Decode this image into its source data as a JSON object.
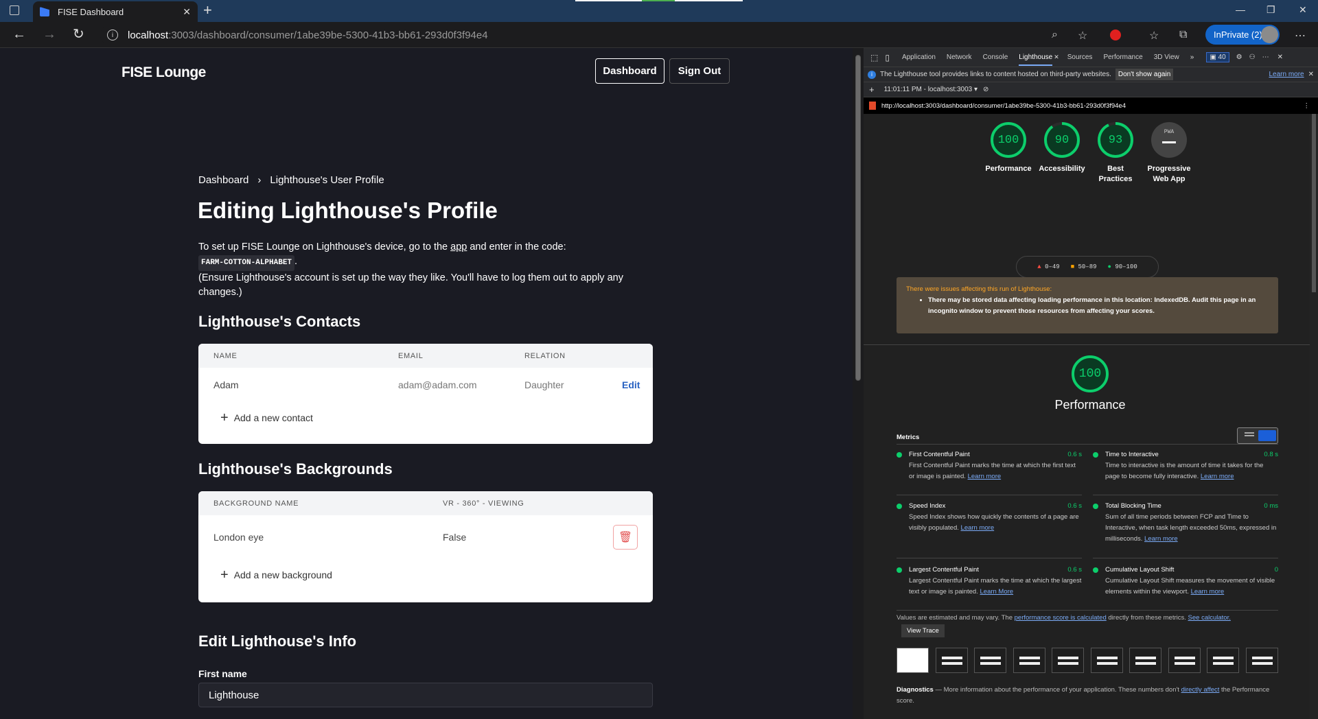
{
  "browser": {
    "tab_title": "FISE Dashboard",
    "url_host": "localhost",
    "url_path": ":3003/dashboard/consumer/1abe39be-5300-41b3-bb61-293d0f3f94e4",
    "inprivate_label": "InPrivate (2)"
  },
  "header": {
    "brand": "FISE Lounge",
    "dashboard_button": "Dashboard",
    "signout_button": "Sign Out"
  },
  "breadcrumb": {
    "root": "Dashboard",
    "separator": "›",
    "current": "Lighthouse's User Profile"
  },
  "page_title": "Editing Lighthouse's Profile",
  "intro": {
    "line1_prefix": "To set up FISE Lounge on Lighthouse's device, go to the ",
    "line1_link": "app",
    "line1_suffix": " and enter in the code:",
    "code": "FARM-COTTON-ALPHABET",
    "code_suffix": ".",
    "line2": "(Ensure Lighthouse's account is set up the way they like. You'll have to log them out to apply any changes.)"
  },
  "contacts": {
    "heading": "Lighthouse's Contacts",
    "columns": [
      "NAME",
      "EMAIL",
      "RELATION"
    ],
    "rows": [
      {
        "name": "Adam",
        "email": "adam@adam.com",
        "relation": "Daughter",
        "action": "Edit"
      }
    ],
    "add_label": "Add a new contact"
  },
  "backgrounds": {
    "heading": "Lighthouse's Backgrounds",
    "columns": [
      "BACKGROUND NAME",
      "VR - 360° - VIEWING"
    ],
    "rows": [
      {
        "name": "London eye",
        "vr": "False"
      }
    ],
    "add_label": "Add a new background"
  },
  "info": {
    "heading": "Edit Lighthouse's Info",
    "first_name_label": "First name",
    "first_name_value": "Lighthouse"
  },
  "devtools": {
    "tabs": [
      "Application",
      "Network",
      "Console",
      "Lighthouse",
      "Sources",
      "Performance",
      "3D View"
    ],
    "active_tab": "Lighthouse",
    "issue_count": "40",
    "info_text": "The Lighthouse tool provides links to content hosted on third-party websites.",
    "dont_show": "Don't show again",
    "learn_more": "Learn more",
    "run_label": "11:01:11 PM - localhost:3003 ▾",
    "report_url": "http://localhost:3003/dashboard/consumer/1abe39be-5300-41b3-bb61-293d0f3f94e4",
    "gauges": [
      {
        "score": "100",
        "label": "Performance"
      },
      {
        "score": "90",
        "label": "Accessibility"
      },
      {
        "score": "93",
        "label": "Best Practices"
      },
      {
        "score": "PWA",
        "label": "Progressive Web App"
      }
    ],
    "legend": [
      "0–49",
      "50–89",
      "90–100"
    ],
    "warning_title": "There were issues affecting this run of Lighthouse:",
    "warning_item": "There may be stored data affecting loading performance in this location: IndexedDB. Audit this page in an incognito window to prevent those resources from affecting your scores.",
    "perf_score": "100",
    "perf_label": "Performance",
    "metrics_label": "Metrics",
    "metrics": [
      {
        "title": "First Contentful Paint",
        "value": "0.6 s",
        "desc": "First Contentful Paint marks the time at which the first text or image is painted.",
        "link": "Learn more"
      },
      {
        "title": "Time to Interactive",
        "value": "0.8 s",
        "desc": "Time to interactive is the amount of time it takes for the page to become fully interactive.",
        "link": "Learn more"
      },
      {
        "title": "Speed Index",
        "value": "0.6 s",
        "desc": "Speed Index shows how quickly the contents of a page are visibly populated.",
        "link": "Learn more"
      },
      {
        "title": "Total Blocking Time",
        "value": "0 ms",
        "desc": "Sum of all time periods between FCP and Time to Interactive, when task length exceeded 50ms, expressed in milliseconds.",
        "link": "Learn more"
      },
      {
        "title": "Largest Contentful Paint",
        "value": "0.6 s",
        "desc": "Largest Contentful Paint marks the time at which the largest text or image is painted.",
        "link": "Learn More"
      },
      {
        "title": "Cumulative Layout Shift",
        "value": "0",
        "desc": "Cumulative Layout Shift measures the movement of visible elements within the viewport.",
        "link": "Learn more"
      }
    ],
    "estimate_prefix": "Values are estimated and may vary. The ",
    "estimate_link": "performance score is calculated",
    "estimate_mid": " directly from these metrics. ",
    "estimate_link2": "See calculator.",
    "view_trace": "View Trace",
    "diag_title": "Diagnostics",
    "diag_text": " — More information about the performance of your application. These numbers don't ",
    "diag_link": "directly affect",
    "diag_suffix": " the Performance score.",
    "colors": {
      "pass": "#0cce6b",
      "average": "#ffa400",
      "fail": "#ff4e42",
      "link": "#7cacf8"
    }
  }
}
